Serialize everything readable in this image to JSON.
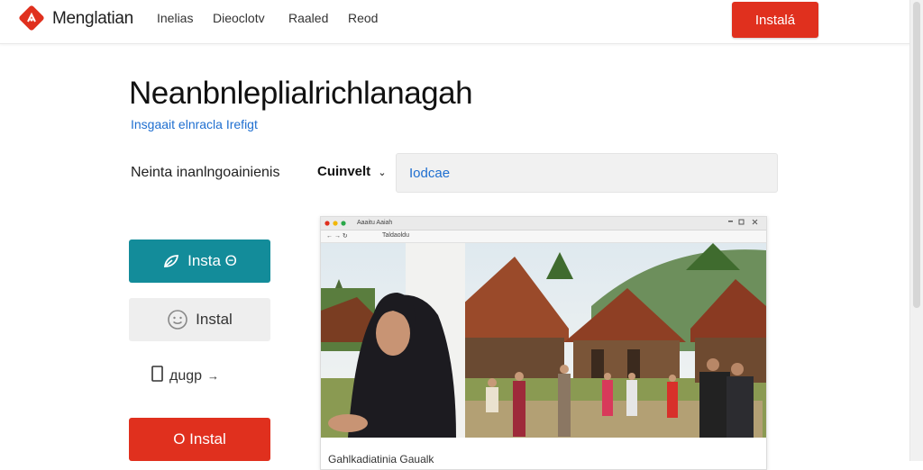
{
  "header": {
    "brand": "Menglatian",
    "nav": [
      "Inelias",
      "Dieoclotv",
      "Raaled",
      "Reod"
    ],
    "install_label": "Instalá"
  },
  "hero": {
    "title": "Neanbnleplialrichlanagah",
    "subtitle": "Insgaait elnracla Irefigt"
  },
  "filter": {
    "label": "Neinta inanlngoainienis",
    "dropdown_value": "Cuinvelt",
    "search_value": "Iodcae"
  },
  "actions": {
    "primary_label": "Insta Θ",
    "secondary_label": "Instal",
    "link_label": "дugр",
    "danger_label": "O Instal"
  },
  "preview": {
    "tab_title": "Aaaitu Aaiah",
    "address": "Taldaoldu",
    "caption": "Gahlkadiatinia Gaualk"
  },
  "colors": {
    "accent_red": "#e0301e",
    "accent_teal": "#138c9a",
    "link_blue": "#1f6fd0"
  },
  "icons": [
    "logo-icon",
    "leaf-icon",
    "smile-icon",
    "document-icon",
    "arrow-icon",
    "chevron-down-icon"
  ]
}
